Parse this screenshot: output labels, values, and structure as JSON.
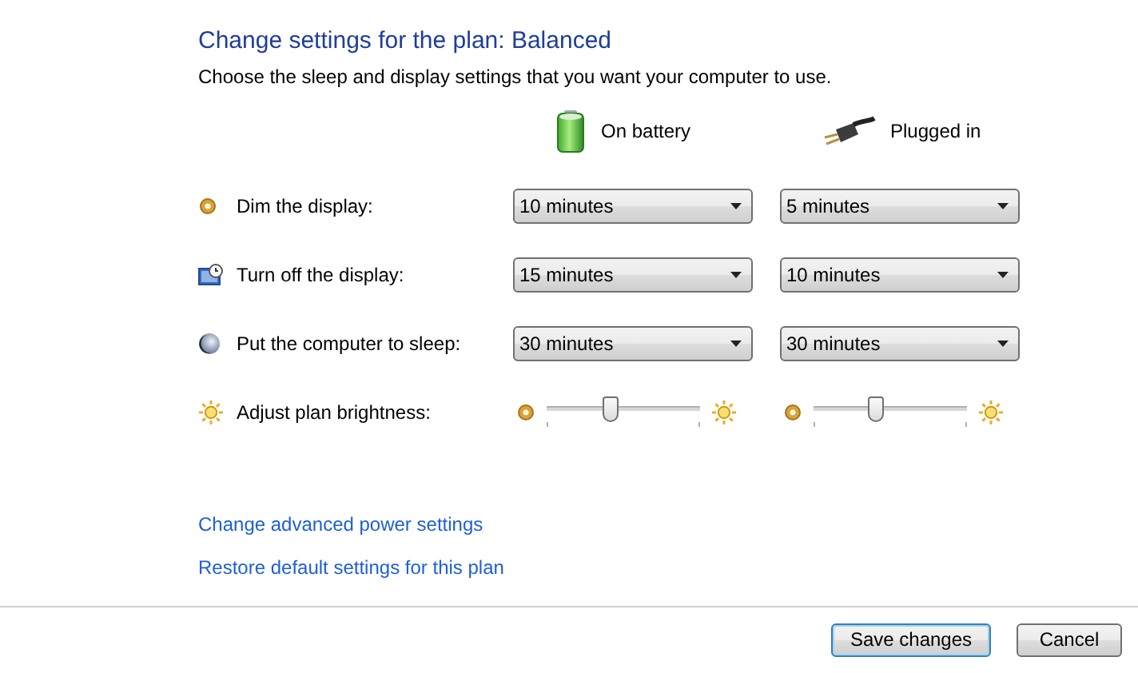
{
  "title": "Change settings for the plan: Balanced",
  "subtitle": "Choose the sleep and display settings that you want your computer to use.",
  "columns": [
    {
      "label": "On battery"
    },
    {
      "label": "Plugged in"
    }
  ],
  "settings": [
    {
      "kind": "dropdown",
      "label": "Dim the display:",
      "values": [
        "10 minutes",
        "5 minutes"
      ]
    },
    {
      "kind": "dropdown",
      "label": "Turn off the display:",
      "values": [
        "15 minutes",
        "10 minutes"
      ]
    },
    {
      "kind": "dropdown",
      "label": "Put the computer to sleep:",
      "values": [
        "30 minutes",
        "30 minutes"
      ]
    },
    {
      "kind": "slider",
      "label": "Adjust plan brightness:",
      "levels": [
        {
          "level": 0.42
        },
        {
          "level": 0.41
        }
      ]
    }
  ],
  "links": [
    "Change advanced power settings",
    "Restore default settings for this plan"
  ],
  "buttons": [
    {
      "label": "Save changes",
      "default": true
    },
    {
      "label": "Cancel",
      "default": false
    }
  ]
}
